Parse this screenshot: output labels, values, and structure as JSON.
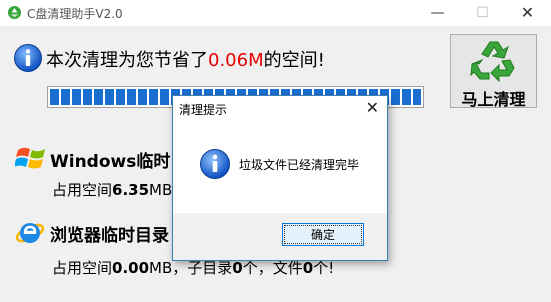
{
  "window": {
    "title": "C盘清理助手V2.0",
    "minimize_glyph": "—",
    "maximize_glyph": "☐",
    "close_glyph": "✕"
  },
  "summary": {
    "prefix": "本次清理为您节省了",
    "amount": "0.06M",
    "suffix": "的空间!"
  },
  "progress": {
    "value": 1.0
  },
  "clean_button": {
    "label": "马上清理",
    "icon": "recycle-icon"
  },
  "sections": {
    "windows_temp": {
      "title": "Windows临时目录",
      "label": "占用空间",
      "size": "6.35",
      "unit": "MB"
    },
    "browser_temp": {
      "title": "浏览器临时目录",
      "label": "占用空间",
      "size": "0.00",
      "unit": "MB",
      "sep1": "，子目录",
      "dirs": "0",
      "dirs_unit": "个",
      "sep2": "，文件",
      "files": "0",
      "files_unit": "个!"
    }
  },
  "dialog": {
    "title": "清理提示",
    "close_glyph": "✕",
    "message": "垃圾文件已经清理完毕",
    "ok_label": "确定",
    "icon": "info-icon"
  },
  "colors": {
    "accent": "#1a6fd1",
    "amount": "#e60000",
    "dialog_border": "#3c7fb1"
  }
}
